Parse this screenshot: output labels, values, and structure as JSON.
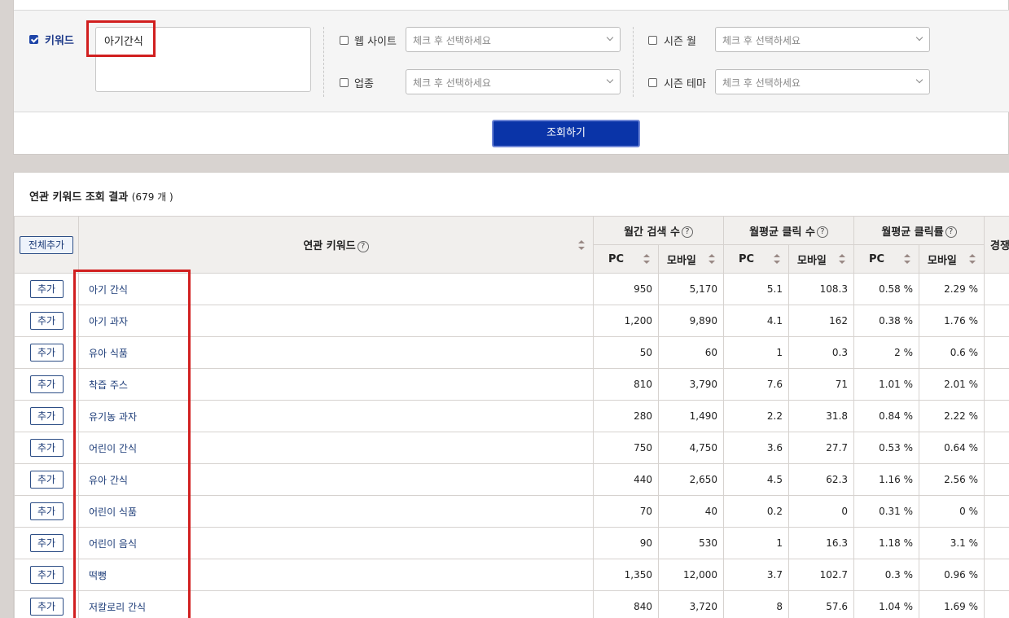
{
  "filters": {
    "keyword_label": "키워드",
    "keyword_value": "아기간식",
    "website_label": "웹 사이트",
    "website_placeholder": "체크 후 선택하세요",
    "season_month_label": "시즌 월",
    "season_month_placeholder": "체크 후 선택하세요",
    "industry_label": "업종",
    "industry_placeholder": "체크 후 선택하세요",
    "season_theme_label": "시즌 테마",
    "season_theme_placeholder": "체크 후 선택하세요",
    "search_button": "조회하기"
  },
  "results": {
    "title": "연관 키워드 조회 결과",
    "count": "(679 개 )",
    "columns": {
      "all_add": "전체추가",
      "keyword": "연관 키워드",
      "monthly_search": "월간 검색 수",
      "avg_clicks": "월평균 클릭 수",
      "avg_ctr": "월평균 클릭률",
      "competition": "경쟁",
      "pc": "PC",
      "mobile": "모바일"
    },
    "add_label": "추가",
    "rows": [
      {
        "keyword": "아기 간식",
        "search_pc": "950",
        "search_mobile": "5,170",
        "click_pc": "5.1",
        "click_mobile": "108.3",
        "ctr_pc": "0.58 %",
        "ctr_mobile": "2.29 %"
      },
      {
        "keyword": "아기 과자",
        "search_pc": "1,200",
        "search_mobile": "9,890",
        "click_pc": "4.1",
        "click_mobile": "162",
        "ctr_pc": "0.38 %",
        "ctr_mobile": "1.76 %"
      },
      {
        "keyword": "유아 식품",
        "search_pc": "50",
        "search_mobile": "60",
        "click_pc": "1",
        "click_mobile": "0.3",
        "ctr_pc": "2 %",
        "ctr_mobile": "0.6 %"
      },
      {
        "keyword": "착즙 주스",
        "search_pc": "810",
        "search_mobile": "3,790",
        "click_pc": "7.6",
        "click_mobile": "71",
        "ctr_pc": "1.01 %",
        "ctr_mobile": "2.01 %"
      },
      {
        "keyword": "유기농 과자",
        "search_pc": "280",
        "search_mobile": "1,490",
        "click_pc": "2.2",
        "click_mobile": "31.8",
        "ctr_pc": "0.84 %",
        "ctr_mobile": "2.22 %"
      },
      {
        "keyword": "어린이 간식",
        "search_pc": "750",
        "search_mobile": "4,750",
        "click_pc": "3.6",
        "click_mobile": "27.7",
        "ctr_pc": "0.53 %",
        "ctr_mobile": "0.64 %"
      },
      {
        "keyword": "유아 간식",
        "search_pc": "440",
        "search_mobile": "2,650",
        "click_pc": "4.5",
        "click_mobile": "62.3",
        "ctr_pc": "1.16 %",
        "ctr_mobile": "2.56 %"
      },
      {
        "keyword": "어린이 식품",
        "search_pc": "70",
        "search_mobile": "40",
        "click_pc": "0.2",
        "click_mobile": "0",
        "ctr_pc": "0.31 %",
        "ctr_mobile": "0 %"
      },
      {
        "keyword": "어린이 음식",
        "search_pc": "90",
        "search_mobile": "530",
        "click_pc": "1",
        "click_mobile": "16.3",
        "ctr_pc": "1.18 %",
        "ctr_mobile": "3.1 %"
      },
      {
        "keyword": "떡뻥",
        "search_pc": "1,350",
        "search_mobile": "12,000",
        "click_pc": "3.7",
        "click_mobile": "102.7",
        "ctr_pc": "0.3 %",
        "ctr_mobile": "0.96 %"
      },
      {
        "keyword": "저칼로리 간식",
        "search_pc": "840",
        "search_mobile": "3,720",
        "click_pc": "8",
        "click_mobile": "57.6",
        "ctr_pc": "1.04 %",
        "ctr_mobile": "1.69 %"
      }
    ]
  },
  "colors": {
    "highlight": "#d11f1f",
    "primary_button": "#0a34a8",
    "keyword_link": "#1d3c78"
  }
}
